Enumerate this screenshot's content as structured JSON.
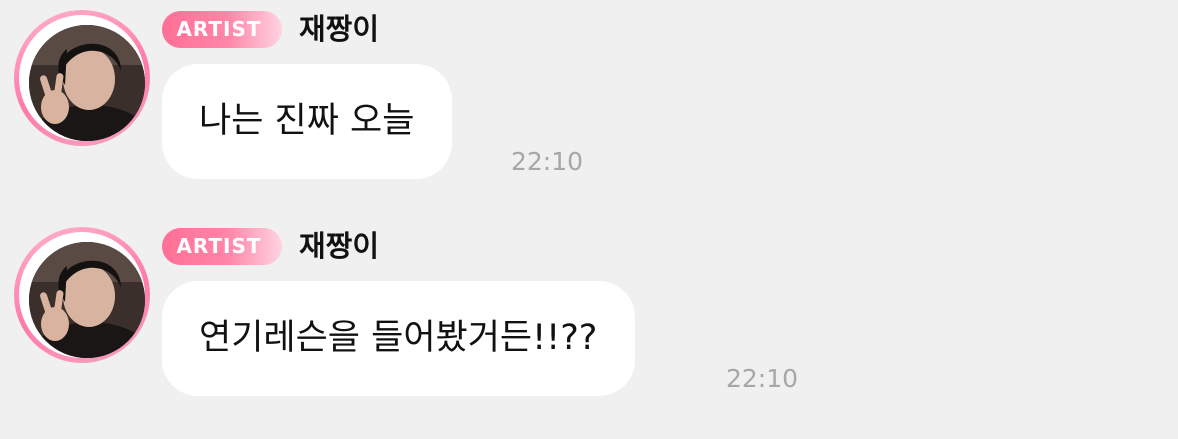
{
  "messages": [
    {
      "badge": "ARTIST",
      "sender": "재짱이",
      "text": "나는 진짜 오늘",
      "time": "22:10"
    },
    {
      "badge": "ARTIST",
      "sender": "재짱이",
      "text": "연기레슨을 들어봤거든!!??",
      "time": "22:10"
    }
  ],
  "colors": {
    "background": "#f0f0f0",
    "bubble": "#ffffff",
    "badge_accent": "#ff6f96",
    "avatar_ring": "#ff7aa8",
    "timestamp": "#a7a7a7"
  }
}
